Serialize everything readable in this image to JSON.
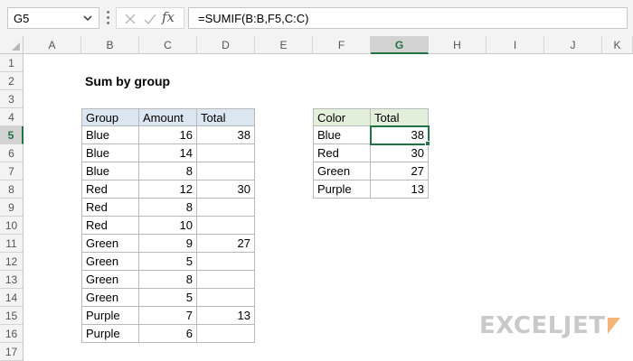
{
  "formula_bar": {
    "name_box": "G5",
    "fx_label": "fx",
    "formula": "=SUMIF(B:B,F5,C:C)"
  },
  "columns": [
    "A",
    "B",
    "C",
    "D",
    "E",
    "F",
    "G",
    "H",
    "I",
    "J",
    "K"
  ],
  "rows": [
    "1",
    "2",
    "3",
    "4",
    "5",
    "6",
    "7",
    "8",
    "9",
    "10",
    "11",
    "12",
    "13",
    "14",
    "15",
    "16",
    "17"
  ],
  "selected": {
    "column": "G",
    "row": "5"
  },
  "sheet": {
    "title": "Sum by group",
    "data_table": {
      "headers": [
        "Group",
        "Amount",
        "Total"
      ],
      "rows": [
        [
          "Blue",
          "16",
          "38"
        ],
        [
          "Blue",
          "14",
          ""
        ],
        [
          "Blue",
          "8",
          ""
        ],
        [
          "Red",
          "12",
          "30"
        ],
        [
          "Red",
          "8",
          ""
        ],
        [
          "Red",
          "10",
          ""
        ],
        [
          "Green",
          "9",
          "27"
        ],
        [
          "Green",
          "5",
          ""
        ],
        [
          "Green",
          "8",
          ""
        ],
        [
          "Green",
          "5",
          ""
        ],
        [
          "Purple",
          "7",
          "13"
        ],
        [
          "Purple",
          "6",
          ""
        ]
      ]
    },
    "summary_table": {
      "headers": [
        "Color",
        "Total"
      ],
      "rows": [
        [
          "Blue",
          "38"
        ],
        [
          "Red",
          "30"
        ],
        [
          "Green",
          "27"
        ],
        [
          "Purple",
          "13"
        ]
      ]
    }
  },
  "logo": {
    "text": "EXCELJET"
  },
  "colors": {
    "header_blue": "#dce6f1",
    "header_green": "#e2efda",
    "selection_green": "#217346",
    "logo_gray": "#c9c9c9",
    "logo_orange": "#f3b578"
  },
  "icons": [
    "chevron-down-icon",
    "cancel-icon",
    "enter-check-icon",
    "function-icon",
    "select-all-icon",
    "exceljet-logo-icon"
  ]
}
